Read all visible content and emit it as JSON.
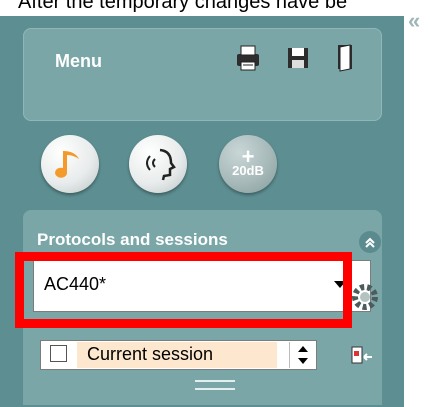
{
  "caption": "After the temporary changes have be",
  "menu": {
    "label": "Menu",
    "icons": [
      "print-icon",
      "save-icon",
      "exit-door-icon"
    ]
  },
  "buttons": [
    {
      "name": "tone-test-button",
      "icon": "music-note-icon"
    },
    {
      "name": "speech-test-button",
      "icon": "speaking-head-icon"
    },
    {
      "name": "plus-20db-button",
      "label": "+\n20dB",
      "text": "20dB"
    }
  ],
  "protocols": {
    "title": "Protocols and sessions",
    "selected": "AC440*",
    "session_label": "Current session"
  },
  "colors": {
    "panel": "#5d8f92",
    "box": "#7aa6a8",
    "highlight": "#ff0000",
    "session_fill": "#fde7cf"
  }
}
